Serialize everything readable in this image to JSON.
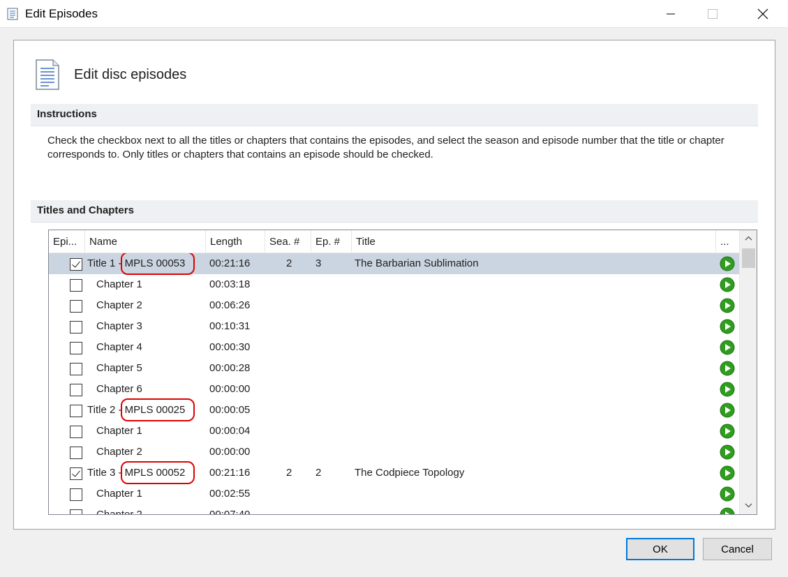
{
  "window": {
    "title": "Edit Episodes"
  },
  "heading": "Edit disc episodes",
  "instructions": {
    "title": "Instructions",
    "text": "Check the checkbox next to all the titles or chapters that contains the episodes, and select the season and episode number that the title or chapter corresponds to. Only titles or chapters that contains an episode should be checked."
  },
  "list": {
    "section_title": "Titles and Chapters",
    "columns": {
      "episode": "Epi...",
      "name": "Name",
      "length": "Length",
      "season": "Sea. #",
      "epnum": "Ep. #",
      "title": "Title",
      "more": "..."
    },
    "rows": [
      {
        "name": "Title 1 - MPLS 00053",
        "length": "00:21:16",
        "season": "2",
        "episode": "3",
        "title": "The Barbarian Sublimation"
      },
      {
        "name": "Chapter 1",
        "length": "00:03:18",
        "season": "",
        "episode": "",
        "title": ""
      },
      {
        "name": "Chapter 2",
        "length": "00:06:26",
        "season": "",
        "episode": "",
        "title": ""
      },
      {
        "name": "Chapter 3",
        "length": "00:10:31",
        "season": "",
        "episode": "",
        "title": ""
      },
      {
        "name": "Chapter 4",
        "length": "00:00:30",
        "season": "",
        "episode": "",
        "title": ""
      },
      {
        "name": "Chapter 5",
        "length": "00:00:28",
        "season": "",
        "episode": "",
        "title": ""
      },
      {
        "name": "Chapter 6",
        "length": "00:00:00",
        "season": "",
        "episode": "",
        "title": ""
      },
      {
        "name": "Title 2 - MPLS 00025",
        "length": "00:00:05",
        "season": "",
        "episode": "",
        "title": ""
      },
      {
        "name": "Chapter 1",
        "length": "00:00:04",
        "season": "",
        "episode": "",
        "title": ""
      },
      {
        "name": "Chapter 2",
        "length": "00:00:00",
        "season": "",
        "episode": "",
        "title": ""
      },
      {
        "name": "Title 3 - MPLS 00052",
        "length": "00:21:16",
        "season": "2",
        "episode": "2",
        "title": "The Codpiece Topology"
      },
      {
        "name": "Chapter 1",
        "length": "00:02:55",
        "season": "",
        "episode": "",
        "title": ""
      },
      {
        "name": "Chapter 2",
        "length": "00:07:40",
        "season": "",
        "episode": "",
        "title": ""
      }
    ]
  },
  "buttons": {
    "ok": "OK",
    "cancel": "Cancel"
  },
  "colors": {
    "selected_row": "#cbd5e1",
    "highlight": "#e00000",
    "play": "#2f9e1f",
    "focus": "#0078d7"
  },
  "icons": {
    "app": "document-icon",
    "play": "play-icon"
  }
}
